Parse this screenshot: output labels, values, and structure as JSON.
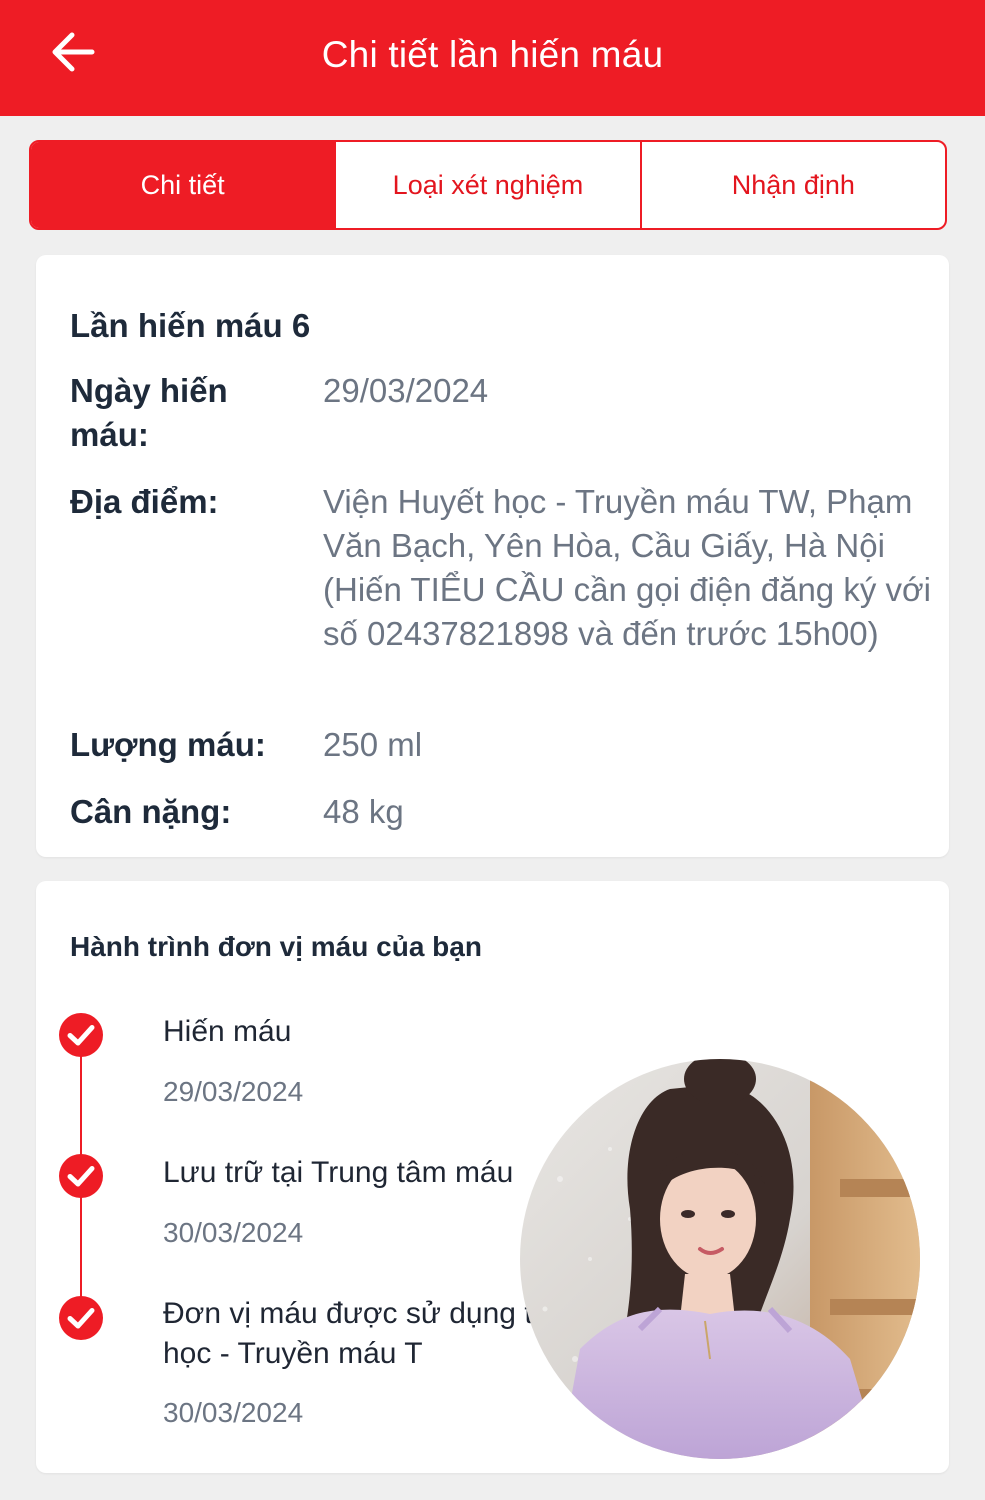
{
  "header": {
    "title": "Chi tiết lần hiến máu"
  },
  "tabs": [
    {
      "label": "Chi tiết"
    },
    {
      "label": "Loại xét nghiệm"
    },
    {
      "label": "Nhận định"
    }
  ],
  "donation": {
    "title": "Lần hiến máu 6",
    "date_label": "Ngày hiến máu:",
    "date_value": "29/03/2024",
    "location_label": "Địa điểm:",
    "location_value": "Viện Huyết học - Truyền máu TW, Phạm Văn Bạch, Yên Hòa, Cầu Giấy, Hà Nội (Hiến TIỂU CẦU cần gọi điện đăng ký với số 02437821898 và đến trước 15h00)",
    "volume_label": "Lượng máu:",
    "volume_value": "250 ml",
    "weight_label": "Cân nặng:",
    "weight_value": "48 kg"
  },
  "journey": {
    "title": "Hành trình đơn vị máu của bạn",
    "steps": [
      {
        "label": "Hiến máu",
        "date": "29/03/2024"
      },
      {
        "label": "Lưu trữ tại Trung tâm máu",
        "date": "30/03/2024"
      },
      {
        "label": "Đơn vị máu được sử dụng tại Viện Huyết học - Truyền máu T",
        "date": "30/03/2024"
      }
    ]
  },
  "colors": {
    "primary": "#ee1c25",
    "text_dark": "#1e2a3a",
    "text_muted": "#6c7583",
    "background": "#efefef"
  }
}
